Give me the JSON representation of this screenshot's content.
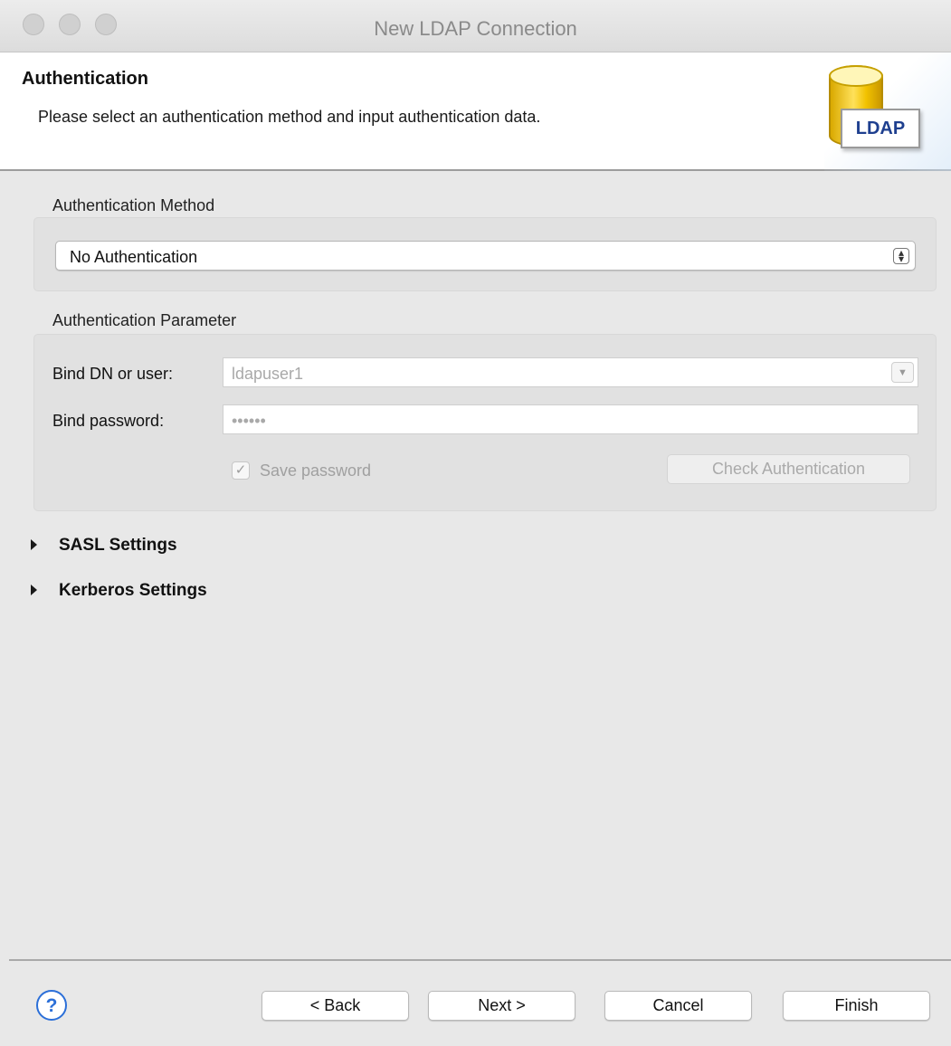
{
  "window": {
    "title": "New LDAP Connection"
  },
  "banner": {
    "heading": "Authentication",
    "description": "Please select an authentication method and input authentication data.",
    "icon_text": "LDAP"
  },
  "auth_method": {
    "group_label": "Authentication Method",
    "selected": "No Authentication"
  },
  "auth_param": {
    "group_label": "Authentication Parameter",
    "bind_dn_label": "Bind DN or user:",
    "bind_dn_value": "ldapuser1",
    "bind_password_label": "Bind password:",
    "bind_password_value": "••••••",
    "save_password_label": "Save password",
    "save_password_checked": true,
    "check_auth_label": "Check Authentication"
  },
  "sections": {
    "sasl": "SASL Settings",
    "kerberos": "Kerberos Settings"
  },
  "footer": {
    "help_glyph": "?",
    "back_label": "< Back",
    "next_label": "Next >",
    "cancel_label": "Cancel",
    "finish_label": "Finish"
  },
  "colors": {
    "dialog_bg": "#e8e8e8",
    "group_bg": "#e1e1e1",
    "help_blue": "#2b6fd8",
    "ldap_text": "#1e3f8f"
  }
}
